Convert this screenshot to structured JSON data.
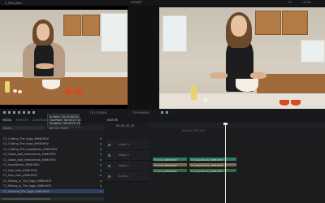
{
  "topbar": {
    "clip_name": "C_Pilot_Kitch",
    "viewer_tab": "VIEWER",
    "right_items": [
      "FX",
      "LOCAL"
    ]
  },
  "source_viewer": {
    "timecode": "T1:17:05:18"
  },
  "program_viewer": {
    "timecode": "T1:00:00:00"
  },
  "tooltip": {
    "line1": "In Point: 00:00:00:00",
    "line2": "Out Point: 00:00:27:13",
    "line3": "Duration: 00:00:27:13"
  },
  "bin": {
    "tabs": [
      "MEDIA",
      "EFFECTS",
      "CONTROLS",
      "HISTORY"
    ],
    "search_placeholder": "Name",
    "sort_label": "Sort By: Folder",
    "items": [
      "C1_Cutting_The_Eggs_4966.MOV",
      "C1_Cutting_The_Eggs_4966.MOV",
      "C1_Cutting_The_Ingredients_4966.MOV",
      "C1_Salad_Add_Instructions_4966.MOV",
      "C1_Salad_Add_Instructions_4966.MOV",
      "C1_Ingredients_4966.MOV",
      "C1_Kiss_Intro_4966.MOV",
      "C1_Kiss_Intro_4966.MOV",
      "C1_Mixing_In_The_Eggs_4966.MOV",
      "C1_Mixing_In_The_Eggs_4966.MOV",
      "C1_Starting_The_Eggs_4966.MOV"
    ],
    "selected_index": 10
  },
  "timeline": {
    "tab": "EDITOR",
    "timecode": "00_00_00_00",
    "sequence_name": "Kitchen Pilot Edit",
    "tracks": [
      {
        "name": "Video 3"
      },
      {
        "name": "Video 2"
      },
      {
        "name": "Video 1"
      },
      {
        "name": "Audio 1"
      }
    ],
    "clips": [
      {
        "label": "C1_Cut_4966.MOV",
        "color": "#2e7d67"
      },
      {
        "label": "C1_Ingredients_4966.MOV",
        "color": "#2e7d67"
      },
      {
        "label": "C1_Cut_4966.MOV",
        "color": "#7a6a52"
      },
      {
        "label": "C1_Ingredients_4966.MOV",
        "color": "#7a6a52"
      },
      {
        "label": "C1_Cut_4966.MOV",
        "color": "#2d6b45"
      },
      {
        "label": "C1_Ingredients_4966.MOV",
        "color": "#2d6b45"
      }
    ]
  }
}
